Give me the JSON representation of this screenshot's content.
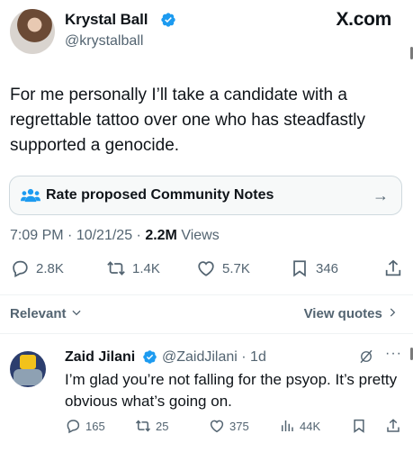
{
  "author": {
    "name": "Krystal Ball",
    "handle": "@krystalball",
    "verified": true
  },
  "brand": "X.com",
  "tweet": {
    "text": "For me personally I’ll take a candidate with a regrettable tattoo over one who has steadfastly supported a genocide."
  },
  "community_notes": {
    "label": "Rate proposed Community Notes",
    "arrow": "→"
  },
  "meta": {
    "time": "7:09 PM",
    "sep1": " · ",
    "date": "10/21/25",
    "sep2": " · ",
    "views": "2.2M",
    "views_label": " Views"
  },
  "actions": {
    "replies": "2.8K",
    "reposts": "1.4K",
    "likes": "5.7K",
    "bookmarks": "346"
  },
  "sort": {
    "relevant": "Relevant",
    "view_quotes": "View quotes"
  },
  "reply": {
    "name": "Zaid Jilani",
    "handle": "@ZaidJilani · 1d",
    "text": "I’m glad you’re not falling for the psyop. It’s pretty obvious what’s going on.",
    "replies": "165",
    "reposts": "25",
    "likes": "375",
    "views": "44K"
  },
  "colors": {
    "verified": "#1d9bf0",
    "muted": "#536471",
    "text": "#0f1419"
  }
}
